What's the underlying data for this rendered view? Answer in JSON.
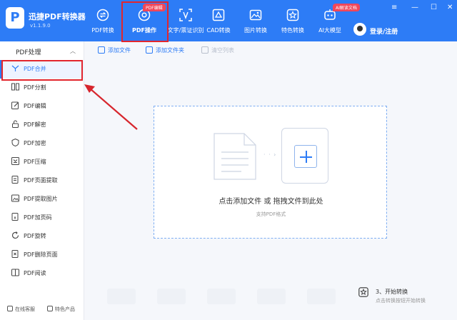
{
  "app": {
    "name": "迅捷PDF转换器",
    "version": "v1.1.9.0",
    "logo_letter": "P"
  },
  "nav": [
    {
      "label": "PDF转换",
      "icon": "convert-icon"
    },
    {
      "label": "PDF操作",
      "icon": "gear-icon",
      "badge": "PDF编辑",
      "active": true
    },
    {
      "label": "文字/票证识别",
      "icon": "ocr-scan-icon"
    },
    {
      "label": "CAD转换",
      "icon": "cad-icon"
    },
    {
      "label": "图片转换",
      "icon": "image-icon"
    },
    {
      "label": "特色转换",
      "icon": "star-box-icon"
    },
    {
      "label": "AI大模型",
      "icon": "ai-icon",
      "badge": "AI解读文档"
    }
  ],
  "user": {
    "login_label": "登录/注册"
  },
  "sidebar": {
    "section_label": "PDF处理",
    "items": [
      {
        "label": "PDF合并",
        "icon": "merge-icon",
        "active": true
      },
      {
        "label": "PDF分割",
        "icon": "split-icon"
      },
      {
        "label": "PDF编辑",
        "icon": "edit-icon"
      },
      {
        "label": "PDF解密",
        "icon": "unlock-icon"
      },
      {
        "label": "PDF加密",
        "icon": "shield-icon"
      },
      {
        "label": "PDF压缩",
        "icon": "compress-icon"
      },
      {
        "label": "PDF页面提取",
        "icon": "page-extract-icon"
      },
      {
        "label": "PDF提取图片",
        "icon": "image-extract-icon"
      },
      {
        "label": "PDF加页码",
        "icon": "page-number-icon"
      },
      {
        "label": "PDF旋转",
        "icon": "rotate-icon"
      },
      {
        "label": "PDF删除页面",
        "icon": "delete-page-icon"
      },
      {
        "label": "PDF阅读",
        "icon": "book-icon"
      }
    ],
    "footer": {
      "service": "在线客服",
      "products": "特色产品"
    }
  },
  "toolbar": {
    "add_file": "添加文件",
    "add_folder": "添加文件夹",
    "clear_list": "清空列表"
  },
  "dropzone": {
    "main_text": "点击添加文件 或 拖拽文件到此处",
    "sub_text": "支持PDF格式"
  },
  "start": {
    "title": "3、开始转换",
    "subtitle": "点击转换按钮开始转换"
  },
  "colors": {
    "brand": "#2d7cf6",
    "highlight": "#e2262d",
    "badge": "#f0475a"
  }
}
